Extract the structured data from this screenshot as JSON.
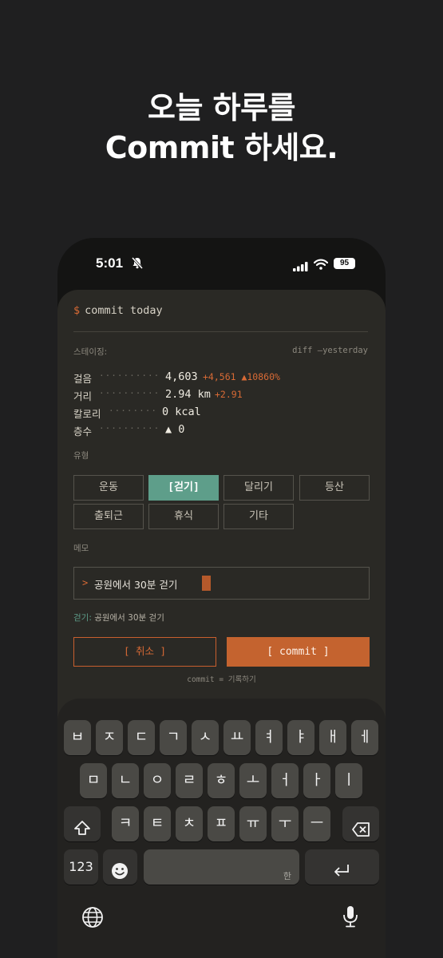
{
  "headline": {
    "line1": "오늘 하루를",
    "line2": "Commit 하세요."
  },
  "status_bar": {
    "time": "5:01",
    "battery": "95"
  },
  "terminal": {
    "prompt_symbol": "$",
    "command": "commit today",
    "staging_label": "스테이징:",
    "diff_label": "diff —yesterday",
    "stats": [
      {
        "key": "걸음",
        "dots": "··········",
        "value": "4,603",
        "delta": "+4,561 ▲10860%"
      },
      {
        "key": "거리",
        "dots": "··········",
        "value": "2.94 km",
        "delta": "+2.91"
      },
      {
        "key": "칼로리",
        "dots": "········",
        "value": "0 kcal",
        "delta": ""
      },
      {
        "key": "층수",
        "dots": "··········",
        "value": "▲ 0",
        "delta": ""
      }
    ],
    "type_label": "유형",
    "types": [
      "운동",
      "[걷기]",
      "달리기",
      "등산",
      "출퇴근",
      "휴식",
      "기타"
    ],
    "selected_type": "[걷기]",
    "memo_label": "메모",
    "memo_prompt": ">",
    "memo_value": "공원에서 30분 걷기",
    "preview_tag": "걷기:",
    "preview_text": "공원에서 30분 걷기",
    "cancel_label": "[ 취소 ]",
    "commit_label": "[ commit ]",
    "hint": "commit = 기록하기"
  },
  "keyboard": {
    "row1": [
      "ㅂ",
      "ㅈ",
      "ㄷ",
      "ㄱ",
      "ㅅ",
      "ㅛ",
      "ㅕ",
      "ㅑ",
      "ㅐ",
      "ㅔ"
    ],
    "row2": [
      "ㅁ",
      "ㄴ",
      "ㅇ",
      "ㄹ",
      "ㅎ",
      "ㅗ",
      "ㅓ",
      "ㅏ",
      "ㅣ"
    ],
    "row3": [
      "ㅋ",
      "ㅌ",
      "ㅊ",
      "ㅍ",
      "ㅠ",
      "ㅜ",
      "ㅡ"
    ],
    "numbers_label": "123",
    "space_lang": "한",
    "icons": [
      "shift-icon",
      "backspace-icon",
      "emoji-icon",
      "return-icon",
      "globe-icon",
      "microphone-icon"
    ]
  },
  "colors": {
    "accent": "#c4632f",
    "selected": "#5e9e8a",
    "background": "#1f1f20",
    "sheet": "#2a2925"
  }
}
